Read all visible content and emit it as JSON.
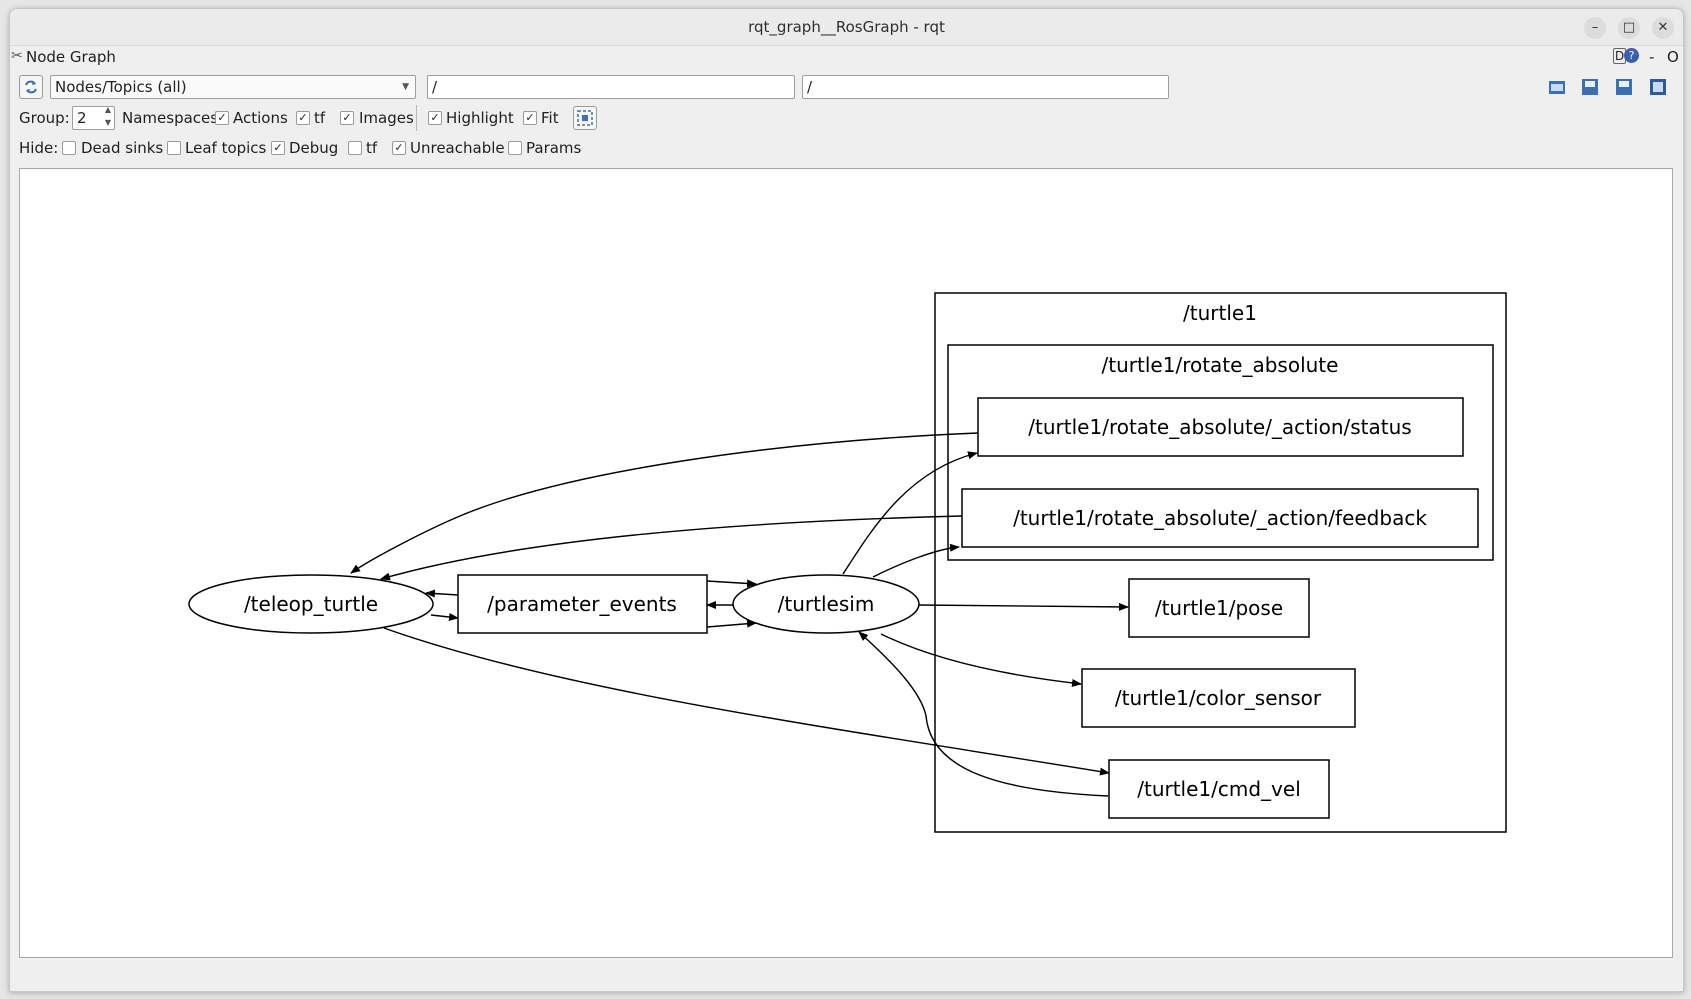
{
  "window": {
    "title": "rqt_graph__RosGraph - rqt"
  },
  "plugin": {
    "title": "Node Graph",
    "right_label": "D",
    "help": "?",
    "dash": "-",
    "close": "O"
  },
  "toolbar": {
    "mode_value": "Nodes/Topics (all)",
    "node_filter": "/",
    "topic_filter": "/"
  },
  "group_row": {
    "group_label": "Group:",
    "group_value": "2",
    "namespaces_label": "Namespaces",
    "options": [
      {
        "label": "Actions",
        "checked": true
      },
      {
        "label": "tf",
        "checked": true
      },
      {
        "label": "Images",
        "checked": true
      },
      {
        "label": "Highlight",
        "checked": true
      },
      {
        "label": "Fit",
        "checked": true
      }
    ]
  },
  "hide_row": {
    "label": "Hide:",
    "options": [
      {
        "label": "Dead sinks",
        "checked": false
      },
      {
        "label": "Leaf topics",
        "checked": false
      },
      {
        "label": "Debug",
        "checked": true
      },
      {
        "label": "tf",
        "checked": false
      },
      {
        "label": "Unreachable",
        "checked": true
      },
      {
        "label": "Params",
        "checked": false
      }
    ]
  },
  "graph": {
    "clusters": {
      "outer": "/turtle1",
      "inner": "/turtle1/rotate_absolute"
    },
    "nodes": {
      "teleop_turtle": "/teleop_turtle",
      "turtlesim": "/turtlesim"
    },
    "topics": {
      "parameter_events": "/parameter_events",
      "status": "/turtle1/rotate_absolute/_action/status",
      "feedback": "/turtle1/rotate_absolute/_action/feedback",
      "pose": "/turtle1/pose",
      "color_sensor": "/turtle1/color_sensor",
      "cmd_vel": "/turtle1/cmd_vel"
    }
  },
  "check_mark": "✓"
}
